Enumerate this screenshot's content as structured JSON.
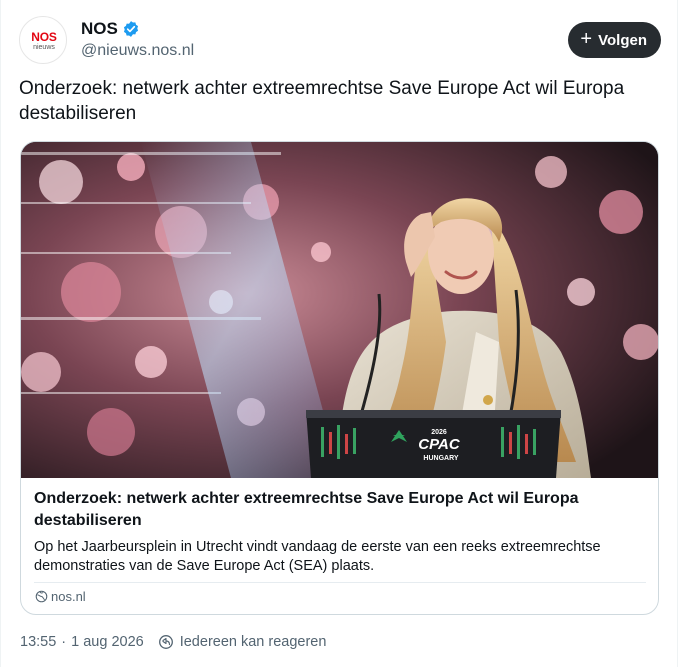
{
  "account": {
    "name": "NOS",
    "handle": "@nieuws.nos.nl",
    "avatar_text": "NOS",
    "avatar_subtext": "nieuws",
    "verified_icon": "verified-badge-icon"
  },
  "actions": {
    "follow_label": "Volgen",
    "follow_icon": "plus-icon"
  },
  "tweet": {
    "text": "Onderzoek: netwerk achter extreemrechtse Save Europe Act wil Europa destabiliseren"
  },
  "card": {
    "title": "Onderzoek: netwerk achter extreemrechtse Save Europe Act wil Europa destabiliseren",
    "description": "Op het Jaarbeursplein in Utrecht vindt vandaag de eerste van een reeks extreemrechtse demonstraties van de Save Europe Act (SEA) plaats.",
    "source": "nos.nl",
    "image": {
      "podium_year": "2026",
      "podium_logo": "CPAC",
      "podium_country": "HUNGARY"
    }
  },
  "meta": {
    "time": "13:55",
    "date": "1 aug 2026",
    "reply_setting": "Iedereen kan reageren"
  },
  "colors": {
    "follow_bg": "#272c30",
    "verified": "#1d9bf0",
    "nos_red": "#e30613",
    "secondary_text": "#536471"
  }
}
